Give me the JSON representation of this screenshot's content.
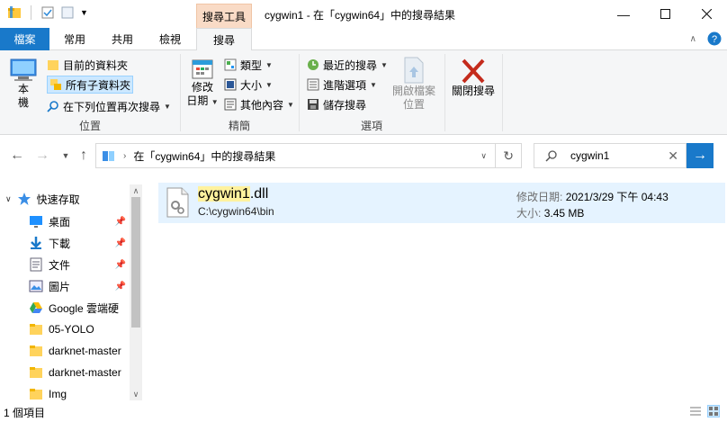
{
  "window": {
    "title": "cygwin1 - 在「cygwin64」中的搜尋結果",
    "context_tab_header": "搜尋工具",
    "minimize_icon": "minimize-icon",
    "maximize_icon": "maximize-icon",
    "close_icon": "close-icon"
  },
  "tabs": {
    "file": "檔案",
    "home": "常用",
    "share": "共用",
    "view": "檢視",
    "search": "搜尋"
  },
  "ribbon": {
    "location": {
      "this_pc": "本\n機",
      "this_pc_line1": "本",
      "this_pc_line2": "機",
      "current_folder": "目前的資料夾",
      "all_subfolders": "所有子資料夾",
      "search_again_in": "在下列位置再次搜尋",
      "label": "位置"
    },
    "refine": {
      "date_modified_line1": "修改",
      "date_modified_line2": "日期",
      "kind": "類型",
      "size": "大小",
      "other_properties": "其他內容",
      "label": "精簡"
    },
    "options": {
      "recent_searches": "最近的搜尋",
      "advanced_options": "進階選項",
      "save_search": "儲存搜尋",
      "open_file_location_line1": "開啟檔案",
      "open_file_location_line2": "位置",
      "label": "選項"
    },
    "close_search": "關閉搜尋"
  },
  "address": {
    "path": "在「cygwin64」中的搜尋結果"
  },
  "search": {
    "query": "cygwin1"
  },
  "nav_pane": {
    "items": [
      {
        "label": "快速存取",
        "icon": "star-icon"
      },
      {
        "label": "桌面",
        "icon": "desktop-icon"
      },
      {
        "label": "下載",
        "icon": "download-icon"
      },
      {
        "label": "文件",
        "icon": "document-icon"
      },
      {
        "label": "圖片",
        "icon": "pictures-icon"
      },
      {
        "label": "Google 雲端硬",
        "icon": "google-drive-icon"
      },
      {
        "label": "05-YOLO",
        "icon": "folder-icon"
      },
      {
        "label": "darknet-master",
        "icon": "folder-icon"
      },
      {
        "label": "darknet-master",
        "icon": "folder-icon"
      },
      {
        "label": "Img",
        "icon": "folder-icon"
      }
    ]
  },
  "result": {
    "name_highlight": "cygwin1",
    "name_rest": ".dll",
    "path": "C:\\cygwin64\\bin",
    "date_label": "修改日期:",
    "date_value": "2021/3/29 下午 04:43",
    "size_label": "大小:",
    "size_value": "3.45 MB"
  },
  "status": {
    "count": "1 個項目"
  },
  "colors": {
    "accent": "#1979ca",
    "context_tab": "#f9dbc6",
    "selection": "#e5f3ff",
    "highlight": "#fff29e"
  }
}
